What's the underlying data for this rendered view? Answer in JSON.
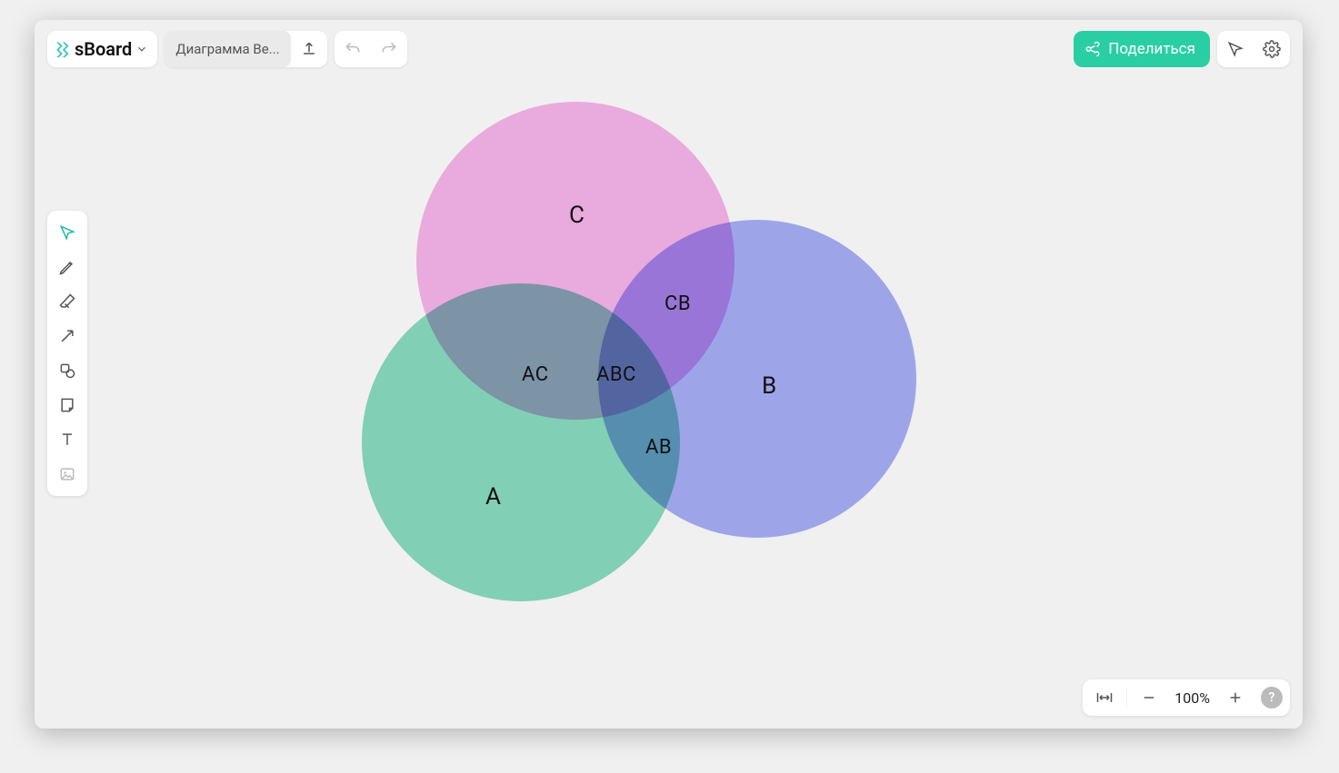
{
  "brand": {
    "name": "sBoard"
  },
  "document": {
    "title": "Диаграмма Ве..."
  },
  "actions": {
    "share_label": "Поделиться"
  },
  "zoom": {
    "level": "100%"
  },
  "toolbar": {
    "items": [
      {
        "name": "select-tool",
        "active": true
      },
      {
        "name": "pencil-tool",
        "active": false
      },
      {
        "name": "eraser-tool",
        "active": false
      },
      {
        "name": "arrow-tool",
        "active": false
      },
      {
        "name": "shape-tool",
        "active": false
      },
      {
        "name": "sticky-note-tool",
        "active": false
      },
      {
        "name": "text-tool",
        "active": false
      },
      {
        "name": "image-tool",
        "active": false
      }
    ]
  },
  "chart_data": {
    "type": "venn",
    "sets": [
      {
        "id": "A",
        "label": "A",
        "color": "#68d2ae"
      },
      {
        "id": "B",
        "label": "B",
        "color": "#8e9af5"
      },
      {
        "id": "C",
        "label": "C",
        "color": "#f6a0e6"
      }
    ],
    "intersections": [
      {
        "sets": [
          "A",
          "C"
        ],
        "label": "AC"
      },
      {
        "sets": [
          "C",
          "B"
        ],
        "label": "CB"
      },
      {
        "sets": [
          "A",
          "B"
        ],
        "label": "AB"
      },
      {
        "sets": [
          "A",
          "B",
          "C"
        ],
        "label": "ABC"
      }
    ],
    "labels": {
      "A": "A",
      "B": "B",
      "C": "C",
      "AC": "AC",
      "CB": "CB",
      "AB": "AB",
      "ABC": "ABC"
    }
  }
}
